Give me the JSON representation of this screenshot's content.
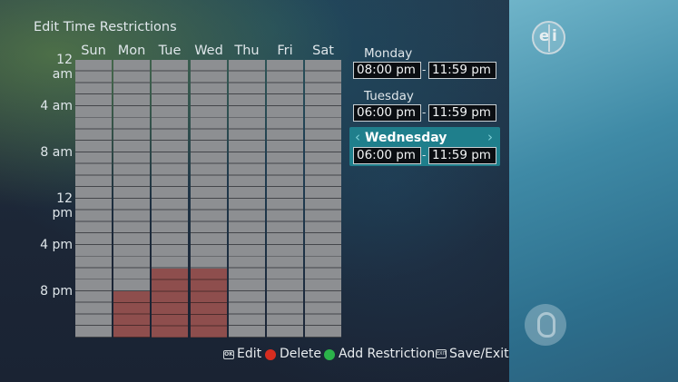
{
  "screen": {
    "title": "Edit Time Restrictions"
  },
  "weekdays": [
    "Sun",
    "Mon",
    "Tue",
    "Wed",
    "Thu",
    "Fri",
    "Sat"
  ],
  "time_labels": [
    "12 am",
    "4 am",
    "8 am",
    "12 pm",
    "4 pm",
    "8 pm"
  ],
  "restrictions": [
    {
      "day": "Monday",
      "start": "08:00 pm",
      "end": "11:59 pm",
      "selected": false
    },
    {
      "day": "Tuesday",
      "start": "06:00 pm",
      "end": "11:59 pm",
      "selected": false
    },
    {
      "day": "Wednesday",
      "start": "06:00 pm",
      "end": "11:59 pm",
      "selected": true
    }
  ],
  "separator": "-",
  "legend": {
    "ok_icon_label": "OK",
    "edit": "Edit",
    "delete": "Delete",
    "add": "Add Restriction",
    "exit_icon_label": "EXIT",
    "save_exit": "Save/Exit"
  },
  "logos": {
    "ei_left": "e",
    "ei_right": "i"
  },
  "colors": {
    "restricted": "#8e4e4d",
    "selected_panel": "#1f7f8c",
    "delete_button": "#d62d20",
    "add_button": "#2bb24a"
  },
  "icons": [
    "chevron-left-icon",
    "chevron-right-icon",
    "ok-button-icon",
    "red-button-icon",
    "green-button-icon",
    "exit-button-icon",
    "ei-logo-icon",
    "pbs-logo-icon"
  ]
}
